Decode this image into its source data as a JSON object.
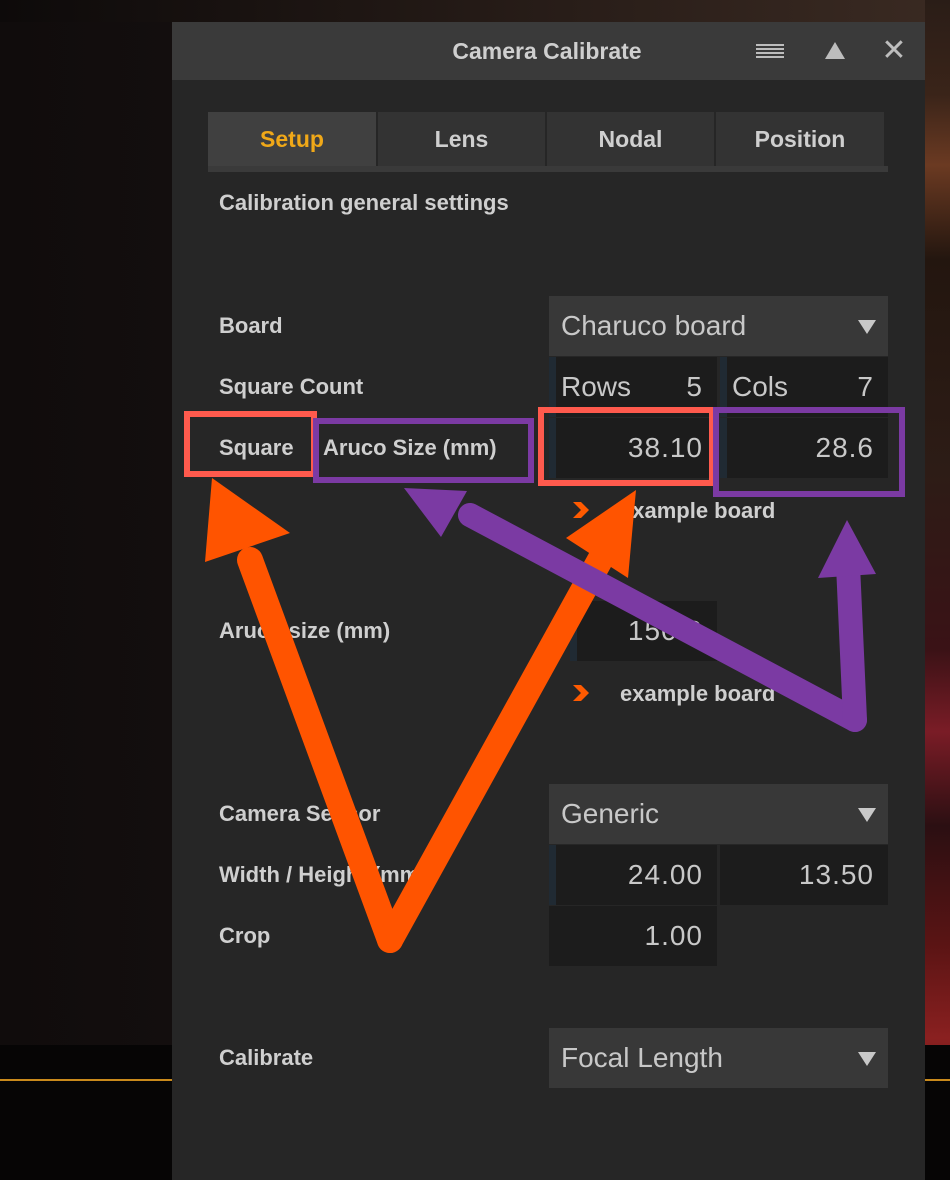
{
  "window": {
    "title": "Camera Calibrate"
  },
  "tabs": [
    {
      "label": "Setup",
      "active": true
    },
    {
      "label": "Lens",
      "active": false
    },
    {
      "label": "Nodal",
      "active": false
    },
    {
      "label": "Position",
      "active": false
    }
  ],
  "setup": {
    "section_title": "Calibration general settings",
    "board": {
      "label": "Board",
      "value": "Charuco board"
    },
    "square_count": {
      "label": "Square Count",
      "rows_label": "Rows",
      "rows": "5",
      "cols_label": "Cols",
      "cols": "7"
    },
    "square_size": {
      "label_square": "Square",
      "label_aruco": "Aruco Size (mm)",
      "square_value": "38.10",
      "aruco_value": "28.6"
    },
    "example_board_1": "example board",
    "aruco_size": {
      "label": "Aruco size (mm)",
      "value": "150.0"
    },
    "example_board_2": "example board",
    "camera_sensor": {
      "label": "Camera Sensor",
      "value": "Generic"
    },
    "width_height": {
      "label": "Width / Height (mm)",
      "width": "24.00",
      "height": "13.50"
    },
    "crop": {
      "label": "Crop",
      "value": "1.00"
    },
    "calibrate": {
      "label": "Calibrate",
      "value": "Focal Length"
    }
  },
  "colors": {
    "accent_tab": "#f0a818",
    "annotation_red": "#ff5a4d",
    "annotation_purple": "#7b3aa3",
    "arrow_orange": "#ff5400",
    "chevron_orange": "#ff5a00"
  },
  "icons": [
    "menu-icon",
    "collapse-up-icon",
    "close-icon",
    "dropdown-arrow-icon",
    "chevron-right-icon"
  ]
}
